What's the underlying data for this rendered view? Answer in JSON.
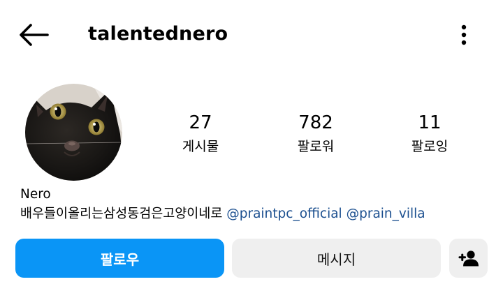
{
  "header": {
    "username": "talentednero",
    "back_icon": "arrow-left-icon",
    "more_icon": "more-vertical-icon"
  },
  "profile": {
    "avatar_icon": "black-cat-avatar",
    "stats": {
      "posts": {
        "value": "27",
        "label": "게시물"
      },
      "followers": {
        "value": "782",
        "label": "팔로워"
      },
      "following": {
        "value": "11",
        "label": "팔로잉"
      }
    },
    "display_name": "Nero",
    "bio": {
      "text": "배우들이올리는삼성동검은고양이네로",
      "mentions": [
        "@praintpc_official",
        "@prain_villa"
      ]
    }
  },
  "actions": {
    "follow_label": "팔로우",
    "message_label": "메시지",
    "add_user_icon": "person-add-icon"
  },
  "colors": {
    "accent": "#0a95f6",
    "mention": "#1b4f8f",
    "secondary_button": "#efefef"
  }
}
